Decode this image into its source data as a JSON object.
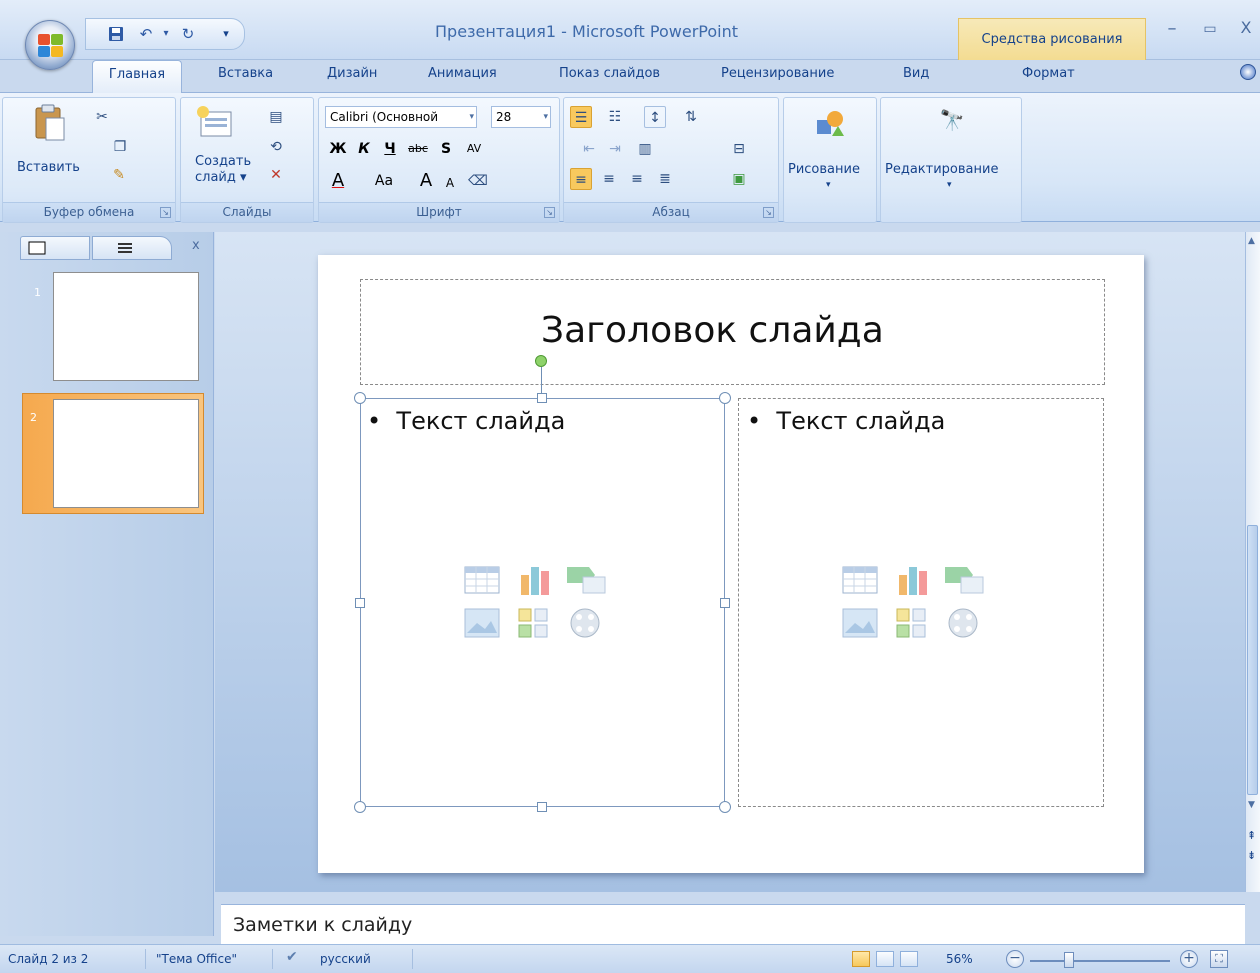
{
  "window": {
    "title": "Презентация1 - Microsoft PowerPoint",
    "context_tab_title": "Средства рисования",
    "controls": {
      "minimize": "–",
      "maximize": "▭",
      "close": "X"
    }
  },
  "qat": {
    "save_icon": "save-icon",
    "undo_icon": "undo-icon",
    "redo_icon": "redo-icon",
    "customize": "▾"
  },
  "tabs": {
    "home": "Главная",
    "insert": "Вставка",
    "design": "Дизайн",
    "animation": "Анимация",
    "slideshow": "Показ слайдов",
    "review": "Рецензирование",
    "view": "Вид",
    "format": "Формат"
  },
  "ribbon": {
    "clipboard": {
      "label": "Буфер обмена",
      "paste": "Вставить"
    },
    "slides": {
      "label": "Слайды",
      "new_slide_line1": "Создать",
      "new_slide_line2": "слайд"
    },
    "font": {
      "label": "Шрифт",
      "font_name": "Calibri (Основной",
      "font_size": "28",
      "bold": "Ж",
      "italic": "К",
      "underline": "Ч",
      "strike": "abc",
      "shadow": "S",
      "spacing": "AV",
      "color": "A",
      "case": "Aa",
      "grow": "A",
      "shrink": "A"
    },
    "paragraph": {
      "label": "Абзац"
    },
    "drawing": {
      "label": "Рисование"
    },
    "editing": {
      "label": "Редактирование"
    }
  },
  "left_panel": {
    "slides": [
      {
        "number": "1"
      },
      {
        "number": "2"
      }
    ],
    "close": "x"
  },
  "slide": {
    "title": "Заголовок слайда",
    "left_bullet": "Текст слайда",
    "right_bullet": "Текст слайда",
    "bullet": "•"
  },
  "notes": {
    "text": "Заметки к слайду"
  },
  "status": {
    "slide_info": "Слайд 2 из 2",
    "theme": "\"Тема Office\"",
    "language": "русский",
    "zoom": "56%"
  },
  "colors": {
    "accent": "#15428b",
    "ribbon": "#dce9f8",
    "selected_thumb": "#f4a34a"
  }
}
